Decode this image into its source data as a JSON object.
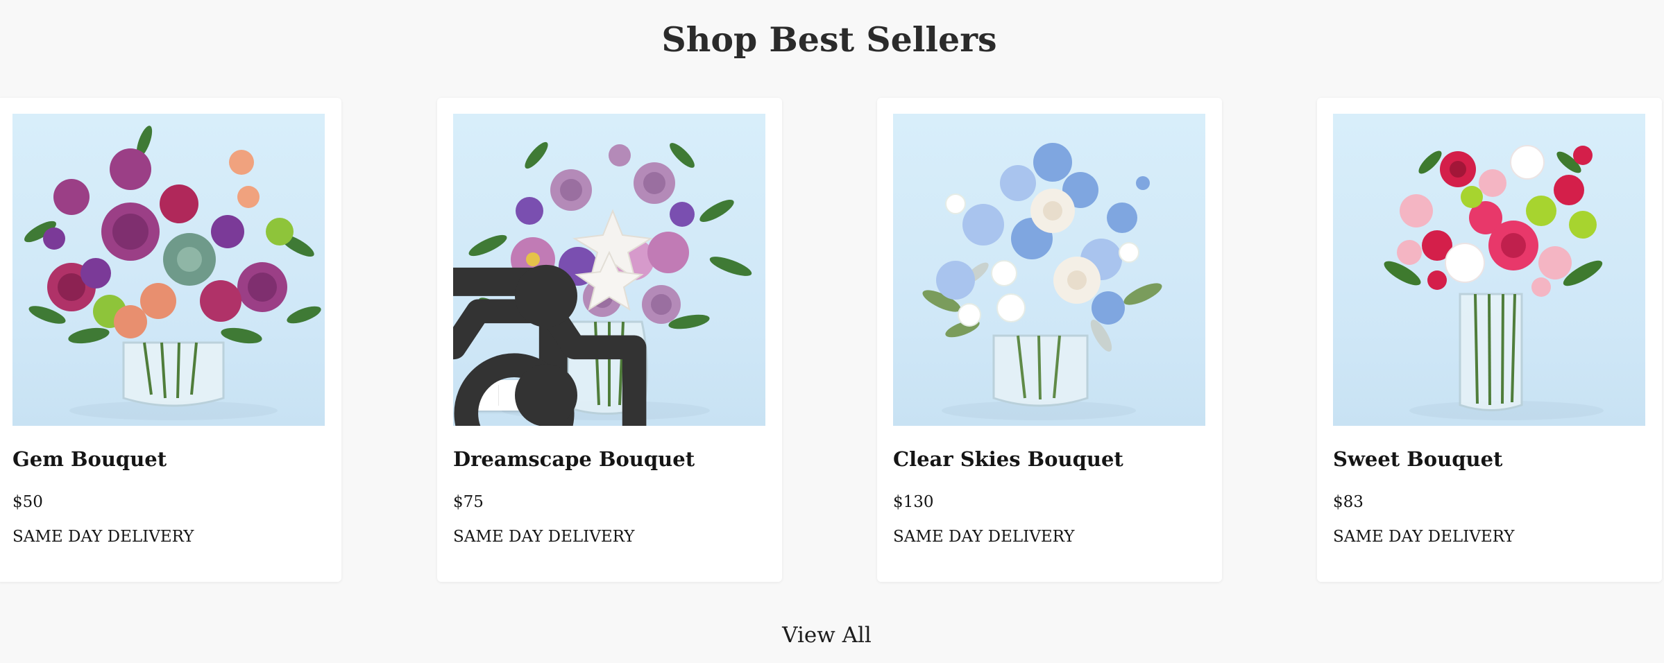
{
  "section": {
    "title": "Shop Best Sellers",
    "view_all_label": "View All"
  },
  "products": [
    {
      "name": "Gem Bouquet",
      "price": "$50",
      "delivery": "SAME DAY DELIVERY",
      "flower_colors": [
        "#9b3f86",
        "#7b3a98",
        "#8ec43a",
        "#e88f6f",
        "#b03268",
        "#6f9a8a"
      ]
    },
    {
      "name": "Dreamscape Bouquet",
      "price": "$75",
      "delivery": "SAME DAY DELIVERY",
      "flower_colors": [
        "#b48ab8",
        "#c17bb5",
        "#f5f3f0",
        "#7a4fb0",
        "#d69acb",
        "#5b8a3a"
      ]
    },
    {
      "name": "Clear Skies Bouquet",
      "price": "$130",
      "delivery": "SAME DAY DELIVERY",
      "flower_colors": [
        "#7fa6e0",
        "#a9c4ee",
        "#f4efe6",
        "#ffffff",
        "#c9d2cf",
        "#7a9c5c"
      ]
    },
    {
      "name": "Sweet Bouquet",
      "price": "$83",
      "delivery": "SAME DAY DELIVERY",
      "flower_colors": [
        "#d41f4a",
        "#f4b5c3",
        "#ffffff",
        "#a7d42f",
        "#e8386a",
        "#3e7a2e"
      ]
    }
  ],
  "image_toolbar": {
    "icons": [
      "bookmark-icon",
      "camera-search-icon",
      "more-vertical-icon"
    ]
  }
}
